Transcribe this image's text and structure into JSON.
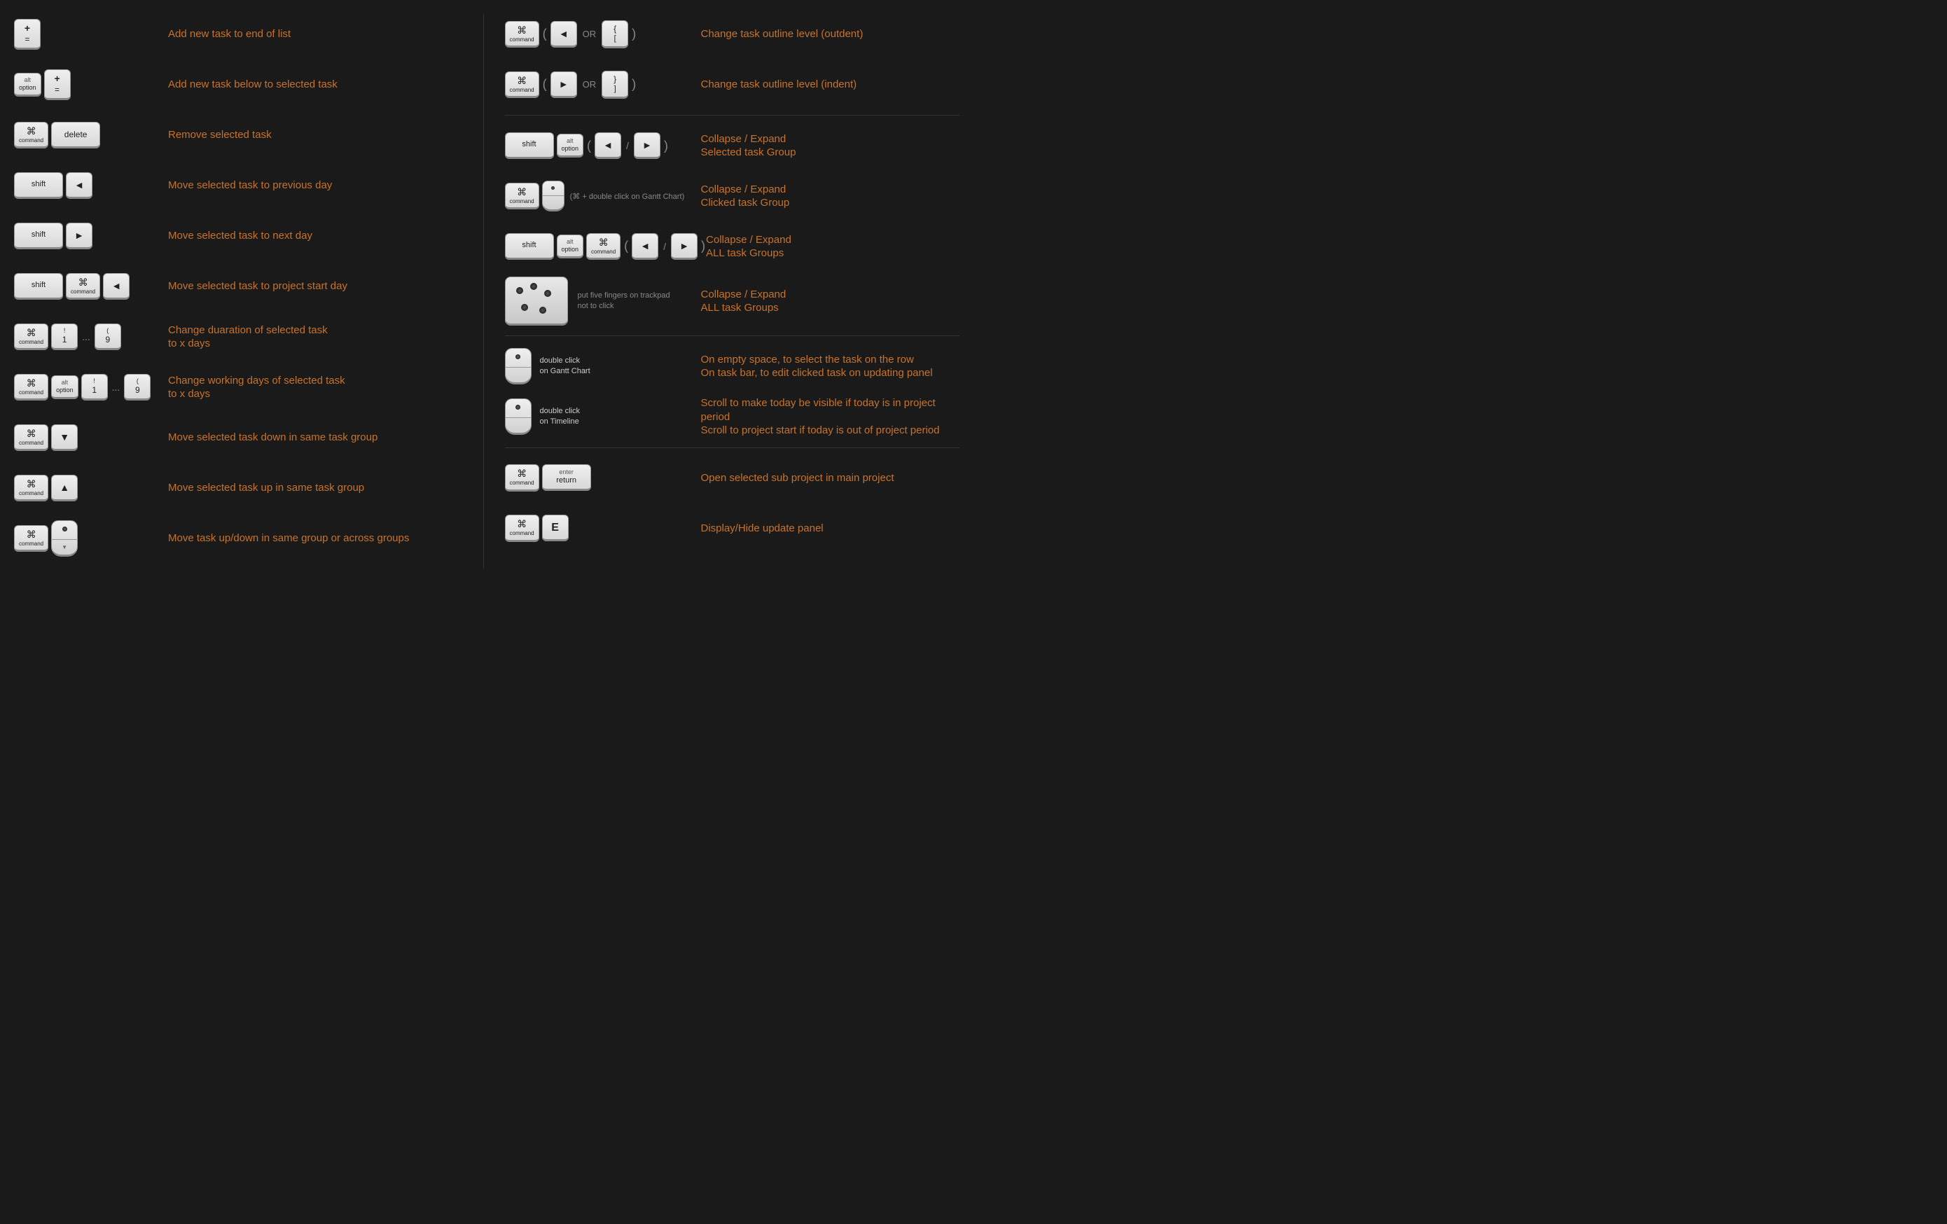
{
  "shortcuts": {
    "left": [
      {
        "id": "add-end",
        "description": "Add new task to end of list",
        "keys_desc": "plus-equal"
      },
      {
        "id": "add-below",
        "description": "Add new task below to selected task",
        "keys_desc": "alt-plus-equal"
      },
      {
        "id": "remove",
        "description": "Remove selected task",
        "keys_desc": "cmd-delete"
      },
      {
        "id": "prev-day",
        "description": "Move selected task to previous day",
        "keys_desc": "shift-left"
      },
      {
        "id": "next-day",
        "description": "Move selected task to next day",
        "keys_desc": "shift-right"
      },
      {
        "id": "start-day",
        "description": "Move selected task to project start day",
        "keys_desc": "shift-cmd-left"
      },
      {
        "id": "duration",
        "description": "Change duaration of selected task\nto x days",
        "keys_desc": "cmd-1-9"
      },
      {
        "id": "working-days",
        "description": "Change working days of selected task\nto x days",
        "keys_desc": "cmd-alt-1-9"
      },
      {
        "id": "move-down",
        "description": "Move selected task down in same task group",
        "keys_desc": "cmd-down"
      },
      {
        "id": "move-up",
        "description": "Move selected task up in same task group",
        "keys_desc": "cmd-up"
      },
      {
        "id": "move-mouse",
        "description": "Move task up/down in same group or across groups",
        "keys_desc": "cmd-mouse"
      }
    ],
    "right": [
      {
        "id": "outdent",
        "description": "Change task outline level (outdent)",
        "keys_desc": "cmd-left-or-brace"
      },
      {
        "id": "indent",
        "description": "Change task outline level (indent)",
        "keys_desc": "cmd-right-or-bracket"
      },
      {
        "id": "divider1"
      },
      {
        "id": "collapse-selected",
        "description": "Collapse / Expand\nSelected task Group",
        "keys_desc": "shift-alt-arrows"
      },
      {
        "id": "collapse-clicked",
        "description": "Collapse / Expand\nClicked task Group",
        "keys_desc": "cmd-dblclick-gantt"
      },
      {
        "id": "collapse-all",
        "description": "Collapse / Expand\nALL task Groups",
        "keys_desc": "shift-alt-cmd-arrows"
      },
      {
        "id": "trackpad-collapse",
        "description": "Collapse / Expand\nALL task Groups",
        "keys_desc": "five-fingers"
      },
      {
        "id": "divider2"
      },
      {
        "id": "dbl-gantt",
        "description": "On empty space, to select the task on the row\nOn task bar,  to edit clicked task on updating panel",
        "keys_desc": "dbl-gantt-chart"
      },
      {
        "id": "dbl-timeline",
        "description": "Scroll to make today be visible if today is in project period\nScroll to project start if today is out of project period",
        "keys_desc": "dbl-timeline"
      },
      {
        "id": "divider3"
      },
      {
        "id": "open-sub",
        "description": "Open selected sub project in main project",
        "keys_desc": "cmd-enter"
      },
      {
        "id": "display-panel",
        "description": "Display/Hide update panel",
        "keys_desc": "cmd-E"
      }
    ]
  },
  "labels": {
    "cmd_symbol": "⌘",
    "cmd_text": "command",
    "alt_text": "alt\noption",
    "shift_text": "shift",
    "delete_text": "delete",
    "return_text": "enter\nreturn",
    "or": "OR",
    "left_arrow": "◄",
    "right_arrow": "►",
    "up_arrow": "▲",
    "down_arrow": "▼",
    "dots": "...",
    "open_paren": "(",
    "close_paren": ")",
    "slash": "/",
    "dbl_gantt_label": "double click\non Gantt Chart",
    "dbl_timeline_label": "double click\non Timeline",
    "five_fingers_label": "put five fingers on trackpad\nnot to click",
    "cmd_dbl_gantt": "(⌘ + double click on Gantt Chart)",
    "e_key": "E"
  }
}
